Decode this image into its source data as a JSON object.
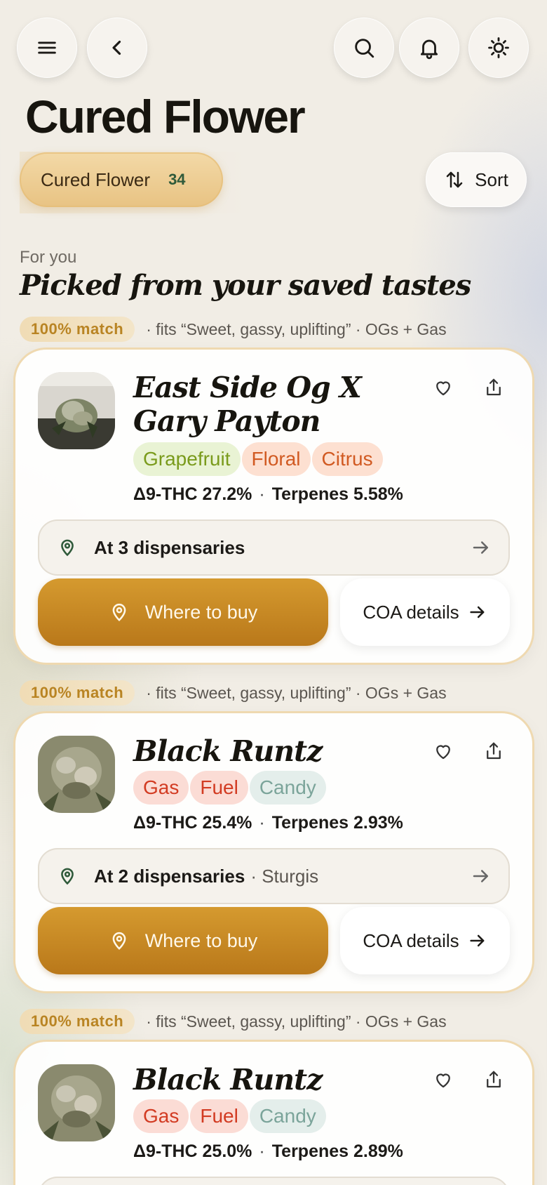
{
  "header": {
    "menu_icon": "menu-icon",
    "back_icon": "chevron-left-icon",
    "search_icon": "search-icon",
    "notifications_icon": "bell-icon",
    "theme_icon": "sun-icon",
    "title": "Cured Flower"
  },
  "filter": {
    "label": "Cured Flower",
    "count": "34",
    "sort_label": "Sort"
  },
  "section": {
    "kicker": "For you",
    "title": "Picked from your saved tastes"
  },
  "colors": {
    "accent": "#c98a25",
    "match": "#b98423",
    "pin": "#2f5a3a"
  },
  "cards": [
    {
      "match": "100% match",
      "match_note": "· fits “Sweet, gassy, uplifting” · OGs + Gas",
      "name_line1": "East Side Og X",
      "name_line2": "Gary Payton",
      "tags": [
        "Grapefruit",
        "Floral",
        "Citrus"
      ],
      "thc": "Δ9-THC 27.2%",
      "sep": "·",
      "terpenes": "Terpenes 5.58%",
      "dispensaries": "At 3 dispensaries",
      "city": "",
      "buy_label": "Where to buy",
      "coa_label": "COA details"
    },
    {
      "match": "100% match",
      "match_note": "· fits “Sweet, gassy, uplifting” · OGs + Gas",
      "name_line1": "Black Runtz",
      "tags": [
        "Gas",
        "Fuel",
        "Candy"
      ],
      "thc": "Δ9-THC 25.4%",
      "sep": "·",
      "terpenes": "Terpenes 2.93%",
      "dispensaries": "At 2 dispensaries",
      "city": "· Sturgis",
      "buy_label": "Where to buy",
      "coa_label": "COA details"
    },
    {
      "match": "100% match",
      "match_note": "· fits “Sweet, gassy, uplifting” · OGs + Gas",
      "name_line1": "Black Runtz",
      "tags": [
        "Gas",
        "Fuel",
        "Candy"
      ],
      "thc": "Δ9-THC 25.0%",
      "sep": "·",
      "terpenes": "Terpenes 2.89%"
    }
  ]
}
